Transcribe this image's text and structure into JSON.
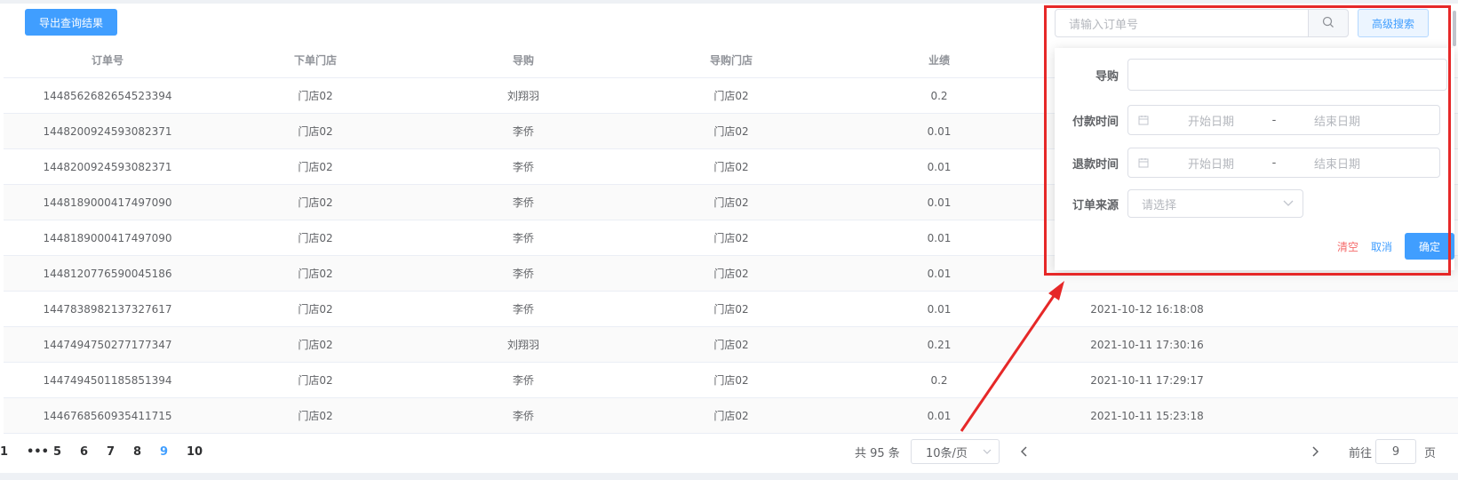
{
  "toolbar": {
    "export_label": "导出查询结果"
  },
  "table": {
    "headers": [
      "订单号",
      "下单门店",
      "导购",
      "导购门店",
      "业绩",
      "",
      ""
    ],
    "rows": [
      [
        "1448562682654523394",
        "门店02",
        "刘翔羽",
        "门店02",
        "0.2",
        "",
        ""
      ],
      [
        "1448200924593082371",
        "门店02",
        "李侨",
        "门店02",
        "0.01",
        "",
        ""
      ],
      [
        "1448200924593082371",
        "门店02",
        "李侨",
        "门店02",
        "0.01",
        "",
        ""
      ],
      [
        "1448189000417497090",
        "门店02",
        "李侨",
        "门店02",
        "0.01",
        "",
        ""
      ],
      [
        "1448189000417497090",
        "门店02",
        "李侨",
        "门店02",
        "0.01",
        "",
        ""
      ],
      [
        "1448120776590045186",
        "门店02",
        "李侨",
        "门店02",
        "0.01",
        "",
        ""
      ],
      [
        "1447838982137327617",
        "门店02",
        "李侨",
        "门店02",
        "0.01",
        "2021-10-12 16:18:08",
        ""
      ],
      [
        "1447494750277177347",
        "门店02",
        "刘翔羽",
        "门店02",
        "0.21",
        "2021-10-11 17:30:16",
        ""
      ],
      [
        "1447494501185851394",
        "门店02",
        "李侨",
        "门店02",
        "0.2",
        "2021-10-11 17:29:17",
        ""
      ],
      [
        "1446768560935411715",
        "门店02",
        "李侨",
        "门店02",
        "0.01",
        "2021-10-11 15:23:18",
        ""
      ]
    ]
  },
  "pagination": {
    "total": "共 95 条",
    "page_size": "10条/页",
    "pages": [
      "1",
      "•••",
      "5",
      "6",
      "7",
      "8",
      "9",
      "10"
    ],
    "current": "9",
    "goto_label": "前往",
    "goto_value": "9",
    "page_suffix": "页"
  },
  "search": {
    "placeholder": "请输入订单号",
    "advanced_label": "高级搜索"
  },
  "advanced_panel": {
    "guide_label": "导购",
    "pay_time_label": "付款时间",
    "refund_time_label": "退款时间",
    "source_label": "订单来源",
    "start_date": "开始日期",
    "end_date": "结束日期",
    "range_sep": "-",
    "select_placeholder": "请选择",
    "clear_label": "清空",
    "cancel_label": "取消",
    "ok_label": "确定"
  },
  "colors": {
    "primary": "#409eff",
    "danger": "#f56c6c",
    "annotation": "#e62828"
  }
}
